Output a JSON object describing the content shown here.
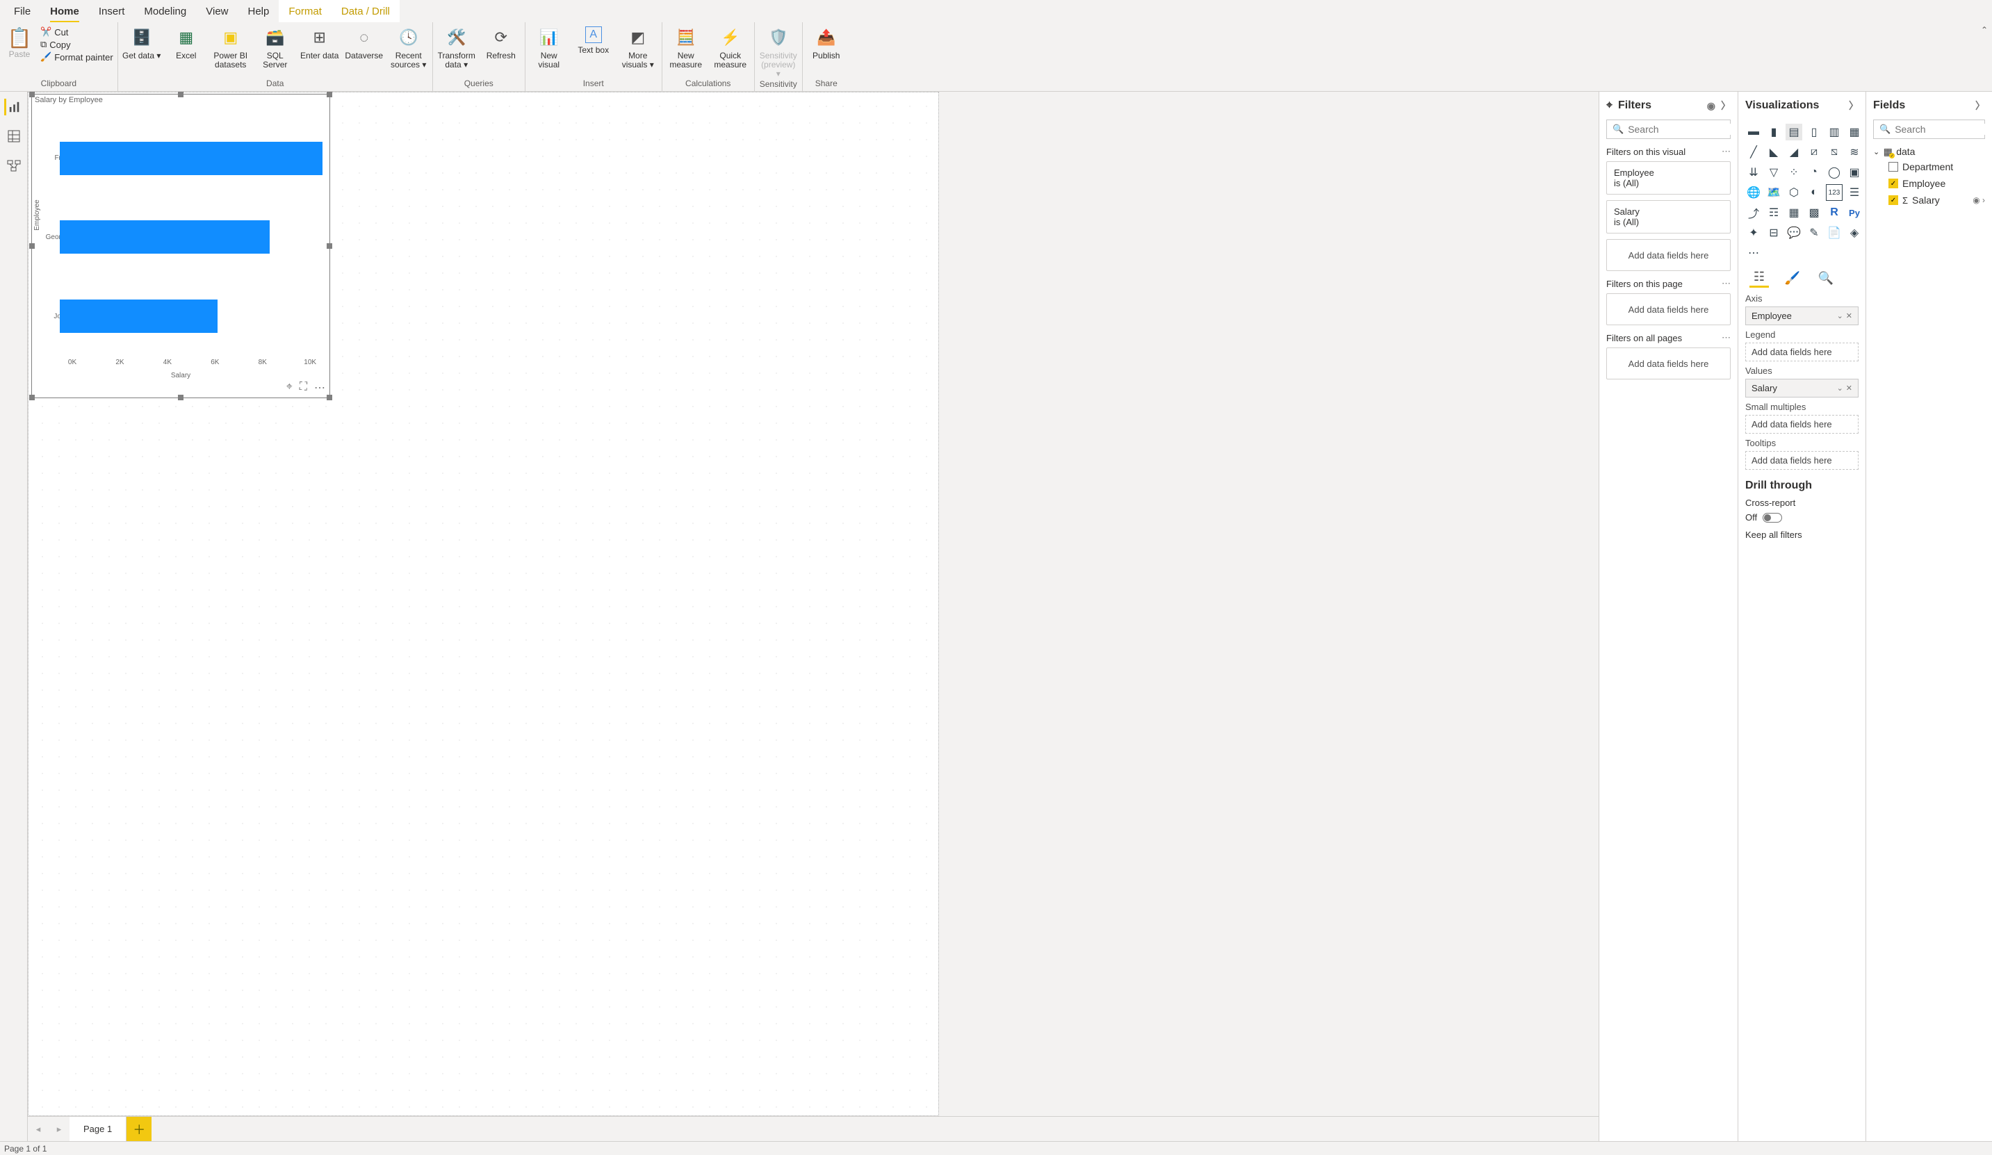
{
  "ribbonTabs": {
    "file": "File",
    "home": "Home",
    "insert": "Insert",
    "modeling": "Modeling",
    "view": "View",
    "help": "Help",
    "format": "Format",
    "datadrill": "Data / Drill"
  },
  "ribbon": {
    "clipboard": {
      "label": "Clipboard",
      "paste": "Paste",
      "cut": "Cut",
      "copy": "Copy",
      "formatPainter": "Format painter"
    },
    "data": {
      "label": "Data",
      "getData": "Get data",
      "excel": "Excel",
      "pbiDatasets": "Power BI datasets",
      "sqlServer": "SQL Server",
      "enterData": "Enter data",
      "dataverse": "Dataverse",
      "recentSources": "Recent sources"
    },
    "queries": {
      "label": "Queries",
      "transform": "Transform data",
      "refresh": "Refresh"
    },
    "insert": {
      "label": "Insert",
      "newVisual": "New visual",
      "textBox": "Text box",
      "moreVisuals": "More visuals"
    },
    "calculations": {
      "label": "Calculations",
      "newMeasure": "New measure",
      "quickMeasure": "Quick measure"
    },
    "sensitivity": {
      "label": "Sensitivity",
      "btn": "Sensitivity (preview)"
    },
    "share": {
      "label": "Share",
      "publish": "Publish"
    }
  },
  "chart_data": {
    "type": "bar",
    "title": "Salary by Employee",
    "xlabel": "Salary",
    "ylabel": "Employee",
    "categories": [
      "Fred",
      "George",
      "John"
    ],
    "values": [
      10000,
      8000,
      6000
    ],
    "xticks": [
      "0K",
      "2K",
      "4K",
      "6K",
      "8K",
      "10K"
    ],
    "xlim": [
      0,
      10000
    ]
  },
  "filters": {
    "title": "Filters",
    "searchPlaceholder": "Search",
    "secVisual": "Filters on this visual",
    "secPage": "Filters on this page",
    "secAll": "Filters on all pages",
    "cardEmployee": {
      "title": "Employee",
      "sub": "is (All)"
    },
    "cardSalary": {
      "title": "Salary",
      "sub": "is (All)"
    },
    "addHere": "Add data fields here"
  },
  "viz": {
    "title": "Visualizations",
    "wells": {
      "axis": "Axis",
      "axisVal": "Employee",
      "legend": "Legend",
      "values": "Values",
      "valuesVal": "Salary",
      "smallMultiples": "Small multiples",
      "tooltips": "Tooltips",
      "addHere": "Add data fields here"
    },
    "drill": {
      "title": "Drill through",
      "crossReport": "Cross-report",
      "off": "Off",
      "keepAll": "Keep all filters"
    }
  },
  "fields": {
    "title": "Fields",
    "searchPlaceholder": "Search",
    "table": "data",
    "items": {
      "department": "Department",
      "employee": "Employee",
      "salary": "Salary"
    }
  },
  "pageTabs": {
    "page1": "Page 1"
  },
  "status": {
    "pageOf": "Page 1 of 1"
  }
}
